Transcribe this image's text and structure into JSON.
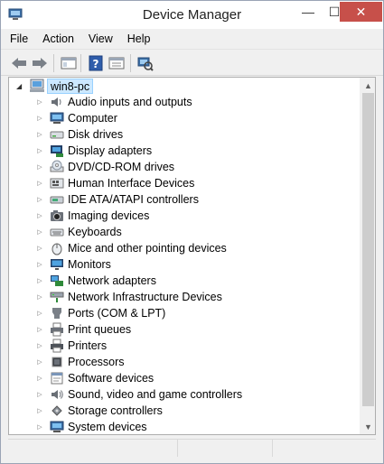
{
  "window": {
    "title": "Device Manager"
  },
  "titlebar": {
    "minimize": "—",
    "maximize": "☐",
    "close": "✕"
  },
  "menu": {
    "items": [
      "File",
      "Action",
      "View",
      "Help"
    ]
  },
  "toolbar": {
    "tools": [
      "back-icon",
      "forward-icon",
      "show-hide-console-tree-icon",
      "help-icon",
      "properties-icon",
      "scan-hardware-icon"
    ]
  },
  "tree": {
    "root_label": "win8-pc",
    "items": [
      {
        "label": "Audio inputs and outputs",
        "icon": "speaker-icon"
      },
      {
        "label": "Computer",
        "icon": "computer-icon"
      },
      {
        "label": "Disk drives",
        "icon": "disk-drive-icon"
      },
      {
        "label": "Display adapters",
        "icon": "display-adapter-icon"
      },
      {
        "label": "DVD/CD-ROM drives",
        "icon": "dvd-drive-icon"
      },
      {
        "label": "Human Interface Devices",
        "icon": "hid-icon"
      },
      {
        "label": "IDE ATA/ATAPI controllers",
        "icon": "ide-controller-icon"
      },
      {
        "label": "Imaging devices",
        "icon": "camera-icon"
      },
      {
        "label": "Keyboards",
        "icon": "keyboard-icon"
      },
      {
        "label": "Mice and other pointing devices",
        "icon": "mouse-icon"
      },
      {
        "label": "Monitors",
        "icon": "monitor-icon"
      },
      {
        "label": "Network adapters",
        "icon": "network-adapter-icon"
      },
      {
        "label": "Network Infrastructure Devices",
        "icon": "network-infrastructure-icon"
      },
      {
        "label": "Ports (COM & LPT)",
        "icon": "port-icon"
      },
      {
        "label": "Print queues",
        "icon": "print-queue-icon"
      },
      {
        "label": "Printers",
        "icon": "printer-icon"
      },
      {
        "label": "Processors",
        "icon": "processor-icon"
      },
      {
        "label": "Software devices",
        "icon": "software-device-icon"
      },
      {
        "label": "Sound, video and game controllers",
        "icon": "sound-controller-icon"
      },
      {
        "label": "Storage controllers",
        "icon": "storage-controller-icon"
      },
      {
        "label": "System devices",
        "icon": "system-device-icon"
      }
    ]
  },
  "colors": {
    "selection_bg": "#cce8ff",
    "selection_border": "#99d1ff",
    "close_button": "#c7504a"
  }
}
